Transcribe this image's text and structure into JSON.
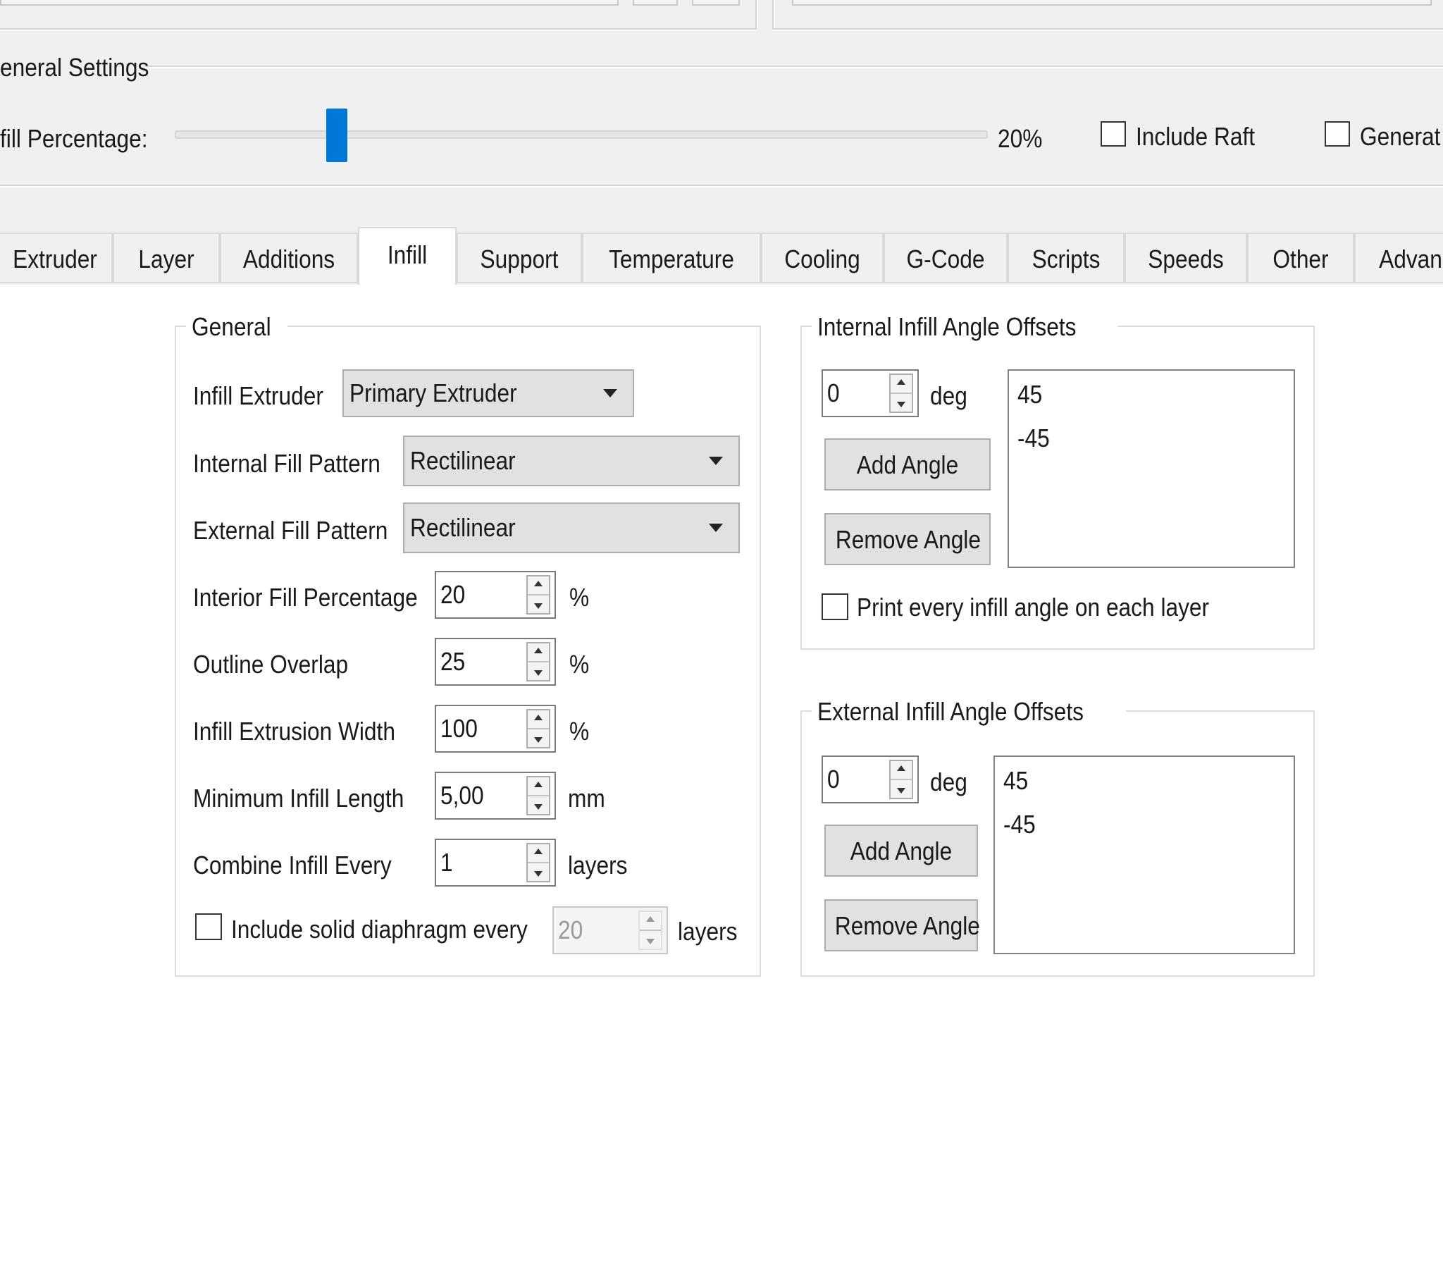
{
  "general_settings": {
    "title": "eneral Settings",
    "fill_label": "fill Percentage:",
    "fill_value": "20%",
    "fill_fraction": 0.2,
    "include_raft": "Include Raft",
    "generate_cut": "Generat"
  },
  "tabs": [
    "Extruder",
    "Layer",
    "Additions",
    "Infill",
    "Support",
    "Temperature",
    "Cooling",
    "G-Code",
    "Scripts",
    "Speeds",
    "Other",
    "Advan"
  ],
  "active_tab": "Infill",
  "general": {
    "title": "General",
    "infill_extruder": {
      "label": "Infill Extruder",
      "value": "Primary Extruder"
    },
    "internal_pattern": {
      "label": "Internal Fill Pattern",
      "value": "Rectilinear"
    },
    "external_pattern": {
      "label": "External Fill Pattern",
      "value": "Rectilinear"
    },
    "interior_pct": {
      "label": "Interior Fill Percentage",
      "value": "20",
      "unit": "%"
    },
    "outline_overlap": {
      "label": "Outline Overlap",
      "value": "25",
      "unit": "%"
    },
    "extrusion_width": {
      "label": "Infill Extrusion Width",
      "value": "100",
      "unit": "%"
    },
    "min_length": {
      "label": "Minimum Infill Length",
      "value": "5,00",
      "unit": "mm"
    },
    "combine_every": {
      "label": "Combine Infill Every",
      "value": "1",
      "unit": "layers"
    },
    "diaphragm": {
      "label": "Include solid diaphragm every",
      "value": "20",
      "unit": "layers"
    }
  },
  "internal_offsets": {
    "title": "Internal Infill Angle Offsets",
    "angle_value": "0",
    "unit": "deg",
    "add_label": "Add Angle",
    "remove_label": "Remove Angle",
    "angles": [
      "45",
      "-45"
    ],
    "print_every": "Print every infill angle on each layer"
  },
  "external_offsets": {
    "title": "External Infill Angle Offsets",
    "angle_value": "0",
    "unit": "deg",
    "add_label": "Add Angle",
    "remove_label": "Remove Angle",
    "angles": [
      "45",
      "-45"
    ]
  }
}
